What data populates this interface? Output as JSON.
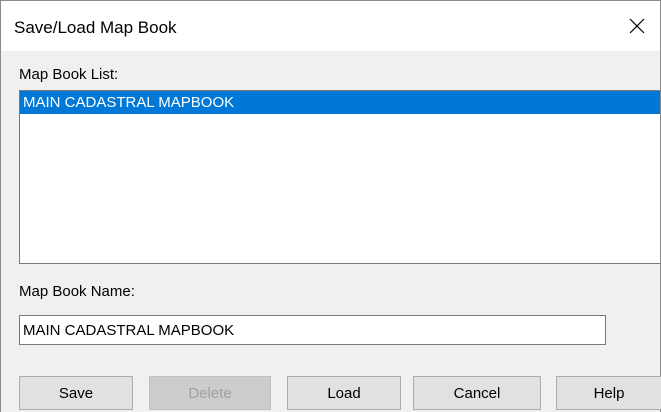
{
  "window": {
    "title": "Save/Load Map Book",
    "close_icon": "close-icon"
  },
  "map_book_list": {
    "label": "Map Book List:",
    "items": [
      {
        "label": "MAIN CADASTRAL MAPBOOK",
        "selected": true
      }
    ]
  },
  "map_book_name": {
    "label": "Map Book Name:",
    "value": "MAIN CADASTRAL MAPBOOK"
  },
  "buttons": {
    "save": "Save",
    "delete": "Delete",
    "load": "Load",
    "cancel": "Cancel",
    "help": "Help"
  },
  "colors": {
    "selection": "#0078d7",
    "dialog_background": "#f0f0f0",
    "button_face": "#e1e1e1"
  }
}
